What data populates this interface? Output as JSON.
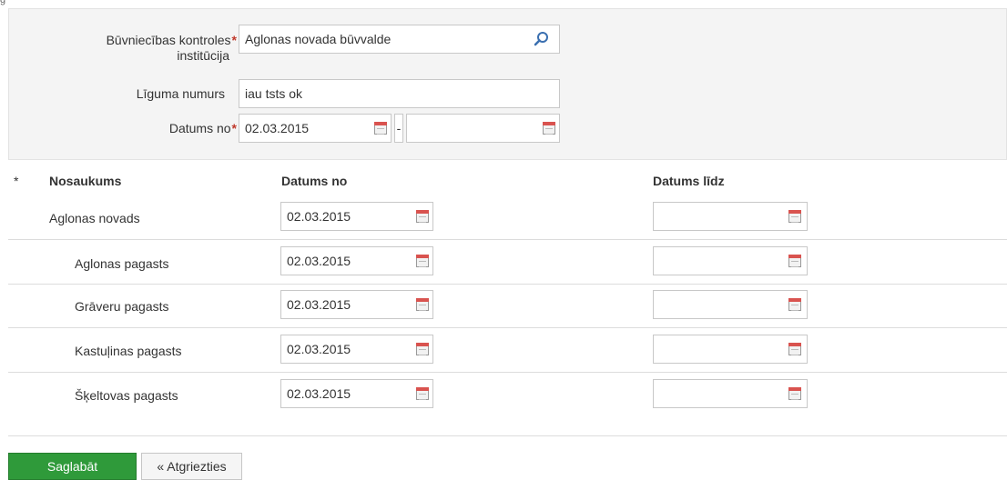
{
  "filter": {
    "institution_label_line1": "Būvniecības kontroles",
    "institution_label_line2": "institūcija",
    "institution_value": "Aglonas novada būvvalde",
    "contract_label": "Līguma numurs",
    "contract_value": "iau tsts ok",
    "date_from_label": "Datums no",
    "date_from_value": "02.03.2015",
    "date_separator": "-",
    "date_to_value": "",
    "required_mark": "*"
  },
  "table": {
    "headers": {
      "mark": "*",
      "name": "Nosaukums",
      "date_from": "Datums no",
      "date_to": "Datums līdz"
    },
    "rows": [
      {
        "name": "Aglonas novads",
        "date_from": "02.03.2015",
        "date_to": ""
      },
      {
        "name": "Aglonas pagasts",
        "date_from": "02.03.2015",
        "date_to": ""
      },
      {
        "name": "Grāveru pagasts",
        "date_from": "02.03.2015",
        "date_to": ""
      },
      {
        "name": "Kastuļinas pagasts",
        "date_from": "02.03.2015",
        "date_to": ""
      },
      {
        "name": "Šķeltovas pagasts",
        "date_from": "02.03.2015",
        "date_to": ""
      }
    ]
  },
  "buttons": {
    "save_label": "Saglabāt",
    "back_label": "« Atgriezties"
  },
  "colors": {
    "required": "#c0392b",
    "save_button": "#2f9a3a",
    "panel_bg": "#f4f4f4"
  },
  "icons": {
    "search": "search-icon",
    "calendar": "calendar-icon"
  }
}
